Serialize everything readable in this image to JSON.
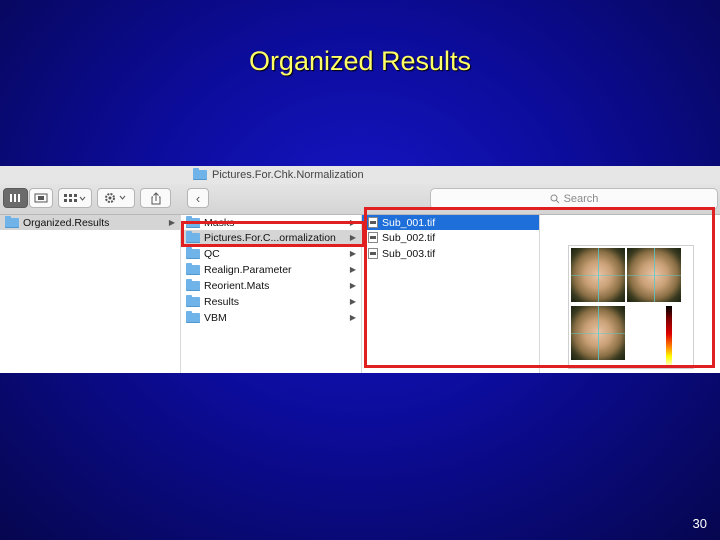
{
  "slide": {
    "title": "Organized Results",
    "page_number": "30"
  },
  "finder": {
    "window_title": "Pictures.For.Chk.Normalization",
    "toolbar": {
      "view_columns_icon": "column-view-icon",
      "view_cover_icon": "cover-flow-icon",
      "group_icon": "group-grid-icon",
      "action_icon": "gear-icon",
      "share_icon": "share-icon",
      "nav_back": "‹",
      "nav_forward": "›"
    },
    "search_placeholder": "Search",
    "column1": {
      "items": [
        {
          "label": "Organized.Results",
          "selected": true
        }
      ]
    },
    "column2": {
      "items": [
        {
          "label": "Masks"
        },
        {
          "label": "Pictures.For.C...ormalization",
          "selected": true
        },
        {
          "label": "QC"
        },
        {
          "label": "Realign.Parameter"
        },
        {
          "label": "Reorient.Mats"
        },
        {
          "label": "Results"
        },
        {
          "label": "VBM"
        }
      ]
    },
    "column3": {
      "items": [
        {
          "label": "Sub_001.tif",
          "selected": true
        },
        {
          "label": "Sub_002.tif"
        },
        {
          "label": "Sub_003.tif"
        }
      ]
    }
  },
  "colors": {
    "title_text": "#ffff66",
    "highlight_box": "#e02020",
    "selection_blue": "#1e6fd9",
    "folder_blue": "#6fb3e8"
  }
}
